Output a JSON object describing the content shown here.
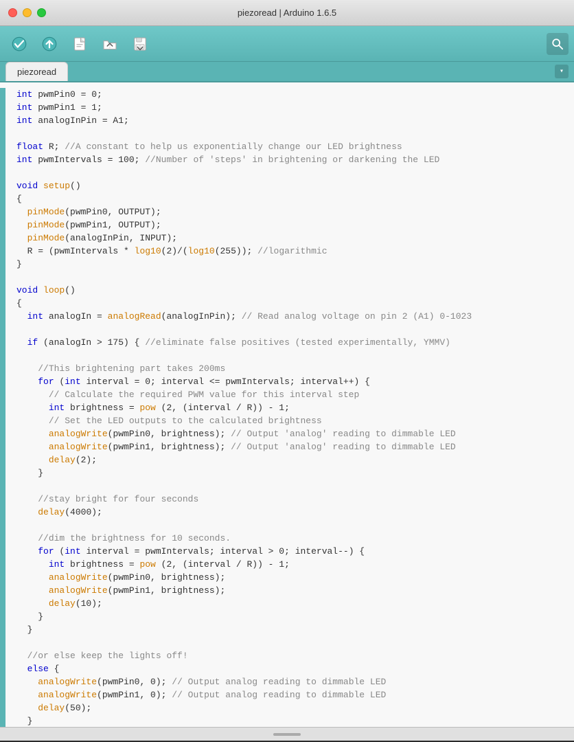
{
  "titleBar": {
    "title": "piezoread | Arduino 1.6.5"
  },
  "toolbar": {
    "verifyLabel": "✓",
    "uploadLabel": "→",
    "newLabel": "📄",
    "openLabel": "↑",
    "saveLabel": "↓",
    "searchLabel": "🔍",
    "buttons": [
      {
        "name": "verify-button",
        "symbol": "✓"
      },
      {
        "name": "upload-button",
        "symbol": "→"
      },
      {
        "name": "new-button",
        "symbol": "□"
      },
      {
        "name": "open-button",
        "symbol": "↑"
      },
      {
        "name": "save-button",
        "symbol": "↓"
      }
    ]
  },
  "tabs": [
    {
      "label": "piezoread",
      "active": true
    }
  ],
  "code": {
    "lines": [
      {
        "indent": 0,
        "tokens": [
          {
            "type": "kw",
            "text": "int"
          },
          {
            "type": "plain",
            "text": " pwmPin0 = 0;"
          }
        ]
      },
      {
        "indent": 0,
        "tokens": [
          {
            "type": "kw",
            "text": "int"
          },
          {
            "type": "plain",
            "text": " pwmPin1 = 1;"
          }
        ]
      },
      {
        "indent": 0,
        "tokens": [
          {
            "type": "kw",
            "text": "int"
          },
          {
            "type": "plain",
            "text": " analogInPin = A1;"
          }
        ]
      },
      {
        "indent": 0,
        "tokens": [
          {
            "type": "plain",
            "text": ""
          }
        ]
      },
      {
        "indent": 0,
        "tokens": [
          {
            "type": "kw",
            "text": "float"
          },
          {
            "type": "plain",
            "text": " R; "
          },
          {
            "type": "cm",
            "text": "//A constant to help us exponentially change our LED brightness"
          }
        ]
      },
      {
        "indent": 0,
        "tokens": [
          {
            "type": "kw",
            "text": "int"
          },
          {
            "type": "plain",
            "text": " pwmIntervals = 100; "
          },
          {
            "type": "cm",
            "text": "//Number of 'steps' in brightening or darkening the LED"
          }
        ]
      },
      {
        "indent": 0,
        "tokens": [
          {
            "type": "plain",
            "text": ""
          }
        ]
      },
      {
        "indent": 0,
        "tokens": [
          {
            "type": "kw",
            "text": "void"
          },
          {
            "type": "plain",
            "text": " "
          },
          {
            "type": "fn",
            "text": "setup"
          },
          {
            "type": "plain",
            "text": "()"
          }
        ]
      },
      {
        "indent": 0,
        "tokens": [
          {
            "type": "plain",
            "text": "{"
          }
        ]
      },
      {
        "indent": 1,
        "tokens": [
          {
            "type": "fn",
            "text": "pinMode"
          },
          {
            "type": "plain",
            "text": "(pwmPin0, OUTPUT);"
          }
        ]
      },
      {
        "indent": 1,
        "tokens": [
          {
            "type": "fn",
            "text": "pinMode"
          },
          {
            "type": "plain",
            "text": "(pwmPin1, OUTPUT);"
          }
        ]
      },
      {
        "indent": 1,
        "tokens": [
          {
            "type": "fn",
            "text": "pinMode"
          },
          {
            "type": "plain",
            "text": "(analogInPin, INPUT);"
          }
        ]
      },
      {
        "indent": 1,
        "tokens": [
          {
            "type": "plain",
            "text": "R = (pwmIntervals * "
          },
          {
            "type": "fn",
            "text": "log10"
          },
          {
            "type": "plain",
            "text": "(2)/("
          },
          {
            "type": "fn",
            "text": "log10"
          },
          {
            "type": "plain",
            "text": "(255)); "
          },
          {
            "type": "cm",
            "text": "//logarithmic"
          }
        ]
      },
      {
        "indent": 0,
        "tokens": [
          {
            "type": "plain",
            "text": "}"
          }
        ]
      },
      {
        "indent": 0,
        "tokens": [
          {
            "type": "plain",
            "text": ""
          }
        ]
      },
      {
        "indent": 0,
        "tokens": [
          {
            "type": "kw",
            "text": "void"
          },
          {
            "type": "plain",
            "text": " "
          },
          {
            "type": "fn",
            "text": "loop"
          },
          {
            "type": "plain",
            "text": "()"
          }
        ]
      },
      {
        "indent": 0,
        "tokens": [
          {
            "type": "plain",
            "text": "{"
          }
        ]
      },
      {
        "indent": 1,
        "tokens": [
          {
            "type": "kw",
            "text": "int"
          },
          {
            "type": "plain",
            "text": " analogIn = "
          },
          {
            "type": "fn",
            "text": "analogRead"
          },
          {
            "type": "plain",
            "text": "(analogInPin); "
          },
          {
            "type": "cm",
            "text": "// Read analog voltage on pin 2 (A1) 0-1023"
          }
        ]
      },
      {
        "indent": 0,
        "tokens": [
          {
            "type": "plain",
            "text": ""
          }
        ]
      },
      {
        "indent": 1,
        "tokens": [
          {
            "type": "kw",
            "text": "if"
          },
          {
            "type": "plain",
            "text": " (analogIn > 175) { "
          },
          {
            "type": "cm",
            "text": "//eliminate false positives (tested experimentally, YMMV)"
          }
        ]
      },
      {
        "indent": 0,
        "tokens": [
          {
            "type": "plain",
            "text": ""
          }
        ]
      },
      {
        "indent": 2,
        "tokens": [
          {
            "type": "cm",
            "text": "//This brightening part takes 200ms"
          }
        ]
      },
      {
        "indent": 2,
        "tokens": [
          {
            "type": "kw",
            "text": "for"
          },
          {
            "type": "plain",
            "text": " ("
          },
          {
            "type": "kw",
            "text": "int"
          },
          {
            "type": "plain",
            "text": " interval = 0; interval <= pwmIntervals; interval++) {"
          }
        ]
      },
      {
        "indent": 3,
        "tokens": [
          {
            "type": "cm",
            "text": "// Calculate the required PWM value for this interval step"
          }
        ]
      },
      {
        "indent": 3,
        "tokens": [
          {
            "type": "kw",
            "text": "int"
          },
          {
            "type": "plain",
            "text": " brightness = "
          },
          {
            "type": "fn",
            "text": "pow"
          },
          {
            "type": "plain",
            "text": " (2, (interval / R)) - 1;"
          }
        ]
      },
      {
        "indent": 3,
        "tokens": [
          {
            "type": "cm",
            "text": "// Set the LED outputs to the calculated brightness"
          }
        ]
      },
      {
        "indent": 3,
        "tokens": [
          {
            "type": "fn",
            "text": "analogWrite"
          },
          {
            "type": "plain",
            "text": "(pwmPin0, brightness); "
          },
          {
            "type": "cm",
            "text": "// Output 'analog' reading to dimmable LED"
          }
        ]
      },
      {
        "indent": 3,
        "tokens": [
          {
            "type": "fn",
            "text": "analogWrite"
          },
          {
            "type": "plain",
            "text": "(pwmPin1, brightness); "
          },
          {
            "type": "cm",
            "text": "// Output 'analog' reading to dimmable LED"
          }
        ]
      },
      {
        "indent": 3,
        "tokens": [
          {
            "type": "fn",
            "text": "delay"
          },
          {
            "type": "plain",
            "text": "(2);"
          }
        ]
      },
      {
        "indent": 2,
        "tokens": [
          {
            "type": "plain",
            "text": "}"
          }
        ]
      },
      {
        "indent": 0,
        "tokens": [
          {
            "type": "plain",
            "text": ""
          }
        ]
      },
      {
        "indent": 2,
        "tokens": [
          {
            "type": "cm",
            "text": "//stay bright for four seconds"
          }
        ]
      },
      {
        "indent": 2,
        "tokens": [
          {
            "type": "fn",
            "text": "delay"
          },
          {
            "type": "plain",
            "text": "(4000);"
          }
        ]
      },
      {
        "indent": 0,
        "tokens": [
          {
            "type": "plain",
            "text": ""
          }
        ]
      },
      {
        "indent": 2,
        "tokens": [
          {
            "type": "cm",
            "text": "//dim the brightness for 10 seconds."
          }
        ]
      },
      {
        "indent": 2,
        "tokens": [
          {
            "type": "kw",
            "text": "for"
          },
          {
            "type": "plain",
            "text": " ("
          },
          {
            "type": "kw",
            "text": "int"
          },
          {
            "type": "plain",
            "text": " interval = pwmIntervals; interval > 0; interval--) {"
          }
        ]
      },
      {
        "indent": 3,
        "tokens": [
          {
            "type": "kw",
            "text": "int"
          },
          {
            "type": "plain",
            "text": " brightness = "
          },
          {
            "type": "fn",
            "text": "pow"
          },
          {
            "type": "plain",
            "text": " (2, (interval / R)) - 1;"
          }
        ]
      },
      {
        "indent": 3,
        "tokens": [
          {
            "type": "fn",
            "text": "analogWrite"
          },
          {
            "type": "plain",
            "text": "(pwmPin0, brightness);"
          }
        ]
      },
      {
        "indent": 3,
        "tokens": [
          {
            "type": "fn",
            "text": "analogWrite"
          },
          {
            "type": "plain",
            "text": "(pwmPin1, brightness);"
          }
        ]
      },
      {
        "indent": 3,
        "tokens": [
          {
            "type": "fn",
            "text": "delay"
          },
          {
            "type": "plain",
            "text": "(10);"
          }
        ]
      },
      {
        "indent": 2,
        "tokens": [
          {
            "type": "plain",
            "text": "}"
          }
        ]
      },
      {
        "indent": 1,
        "tokens": [
          {
            "type": "plain",
            "text": "}"
          }
        ]
      },
      {
        "indent": 0,
        "tokens": [
          {
            "type": "plain",
            "text": ""
          }
        ]
      },
      {
        "indent": 1,
        "tokens": [
          {
            "type": "cm",
            "text": "//or else keep the lights off!"
          }
        ]
      },
      {
        "indent": 1,
        "tokens": [
          {
            "type": "kw",
            "text": "else"
          },
          {
            "type": "plain",
            "text": " {"
          }
        ]
      },
      {
        "indent": 2,
        "tokens": [
          {
            "type": "fn",
            "text": "analogWrite"
          },
          {
            "type": "plain",
            "text": "(pwmPin0, 0); "
          },
          {
            "type": "cm",
            "text": "// Output analog reading to dimmable LED"
          }
        ]
      },
      {
        "indent": 2,
        "tokens": [
          {
            "type": "fn",
            "text": "analogWrite"
          },
          {
            "type": "plain",
            "text": "(pwmPin1, 0); "
          },
          {
            "type": "cm",
            "text": "// Output analog reading to dimmable LED"
          }
        ]
      },
      {
        "indent": 2,
        "tokens": [
          {
            "type": "fn",
            "text": "delay"
          },
          {
            "type": "plain",
            "text": "(50);"
          }
        ]
      },
      {
        "indent": 1,
        "tokens": [
          {
            "type": "plain",
            "text": "}"
          }
        ]
      },
      {
        "indent": 0,
        "tokens": [
          {
            "type": "plain",
            "text": "}"
          }
        ]
      }
    ]
  }
}
